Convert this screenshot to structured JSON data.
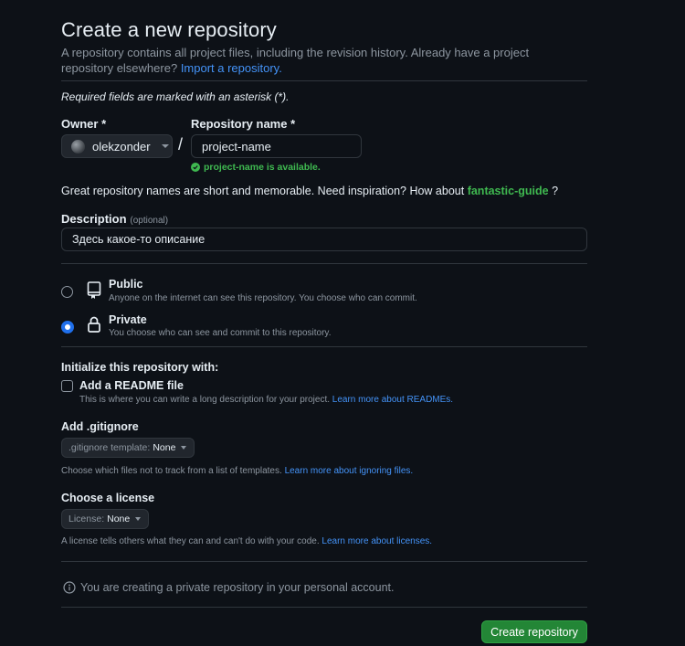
{
  "header": {
    "title": "Create a new repository",
    "subtitle_text": "A repository contains all project files, including the revision history. Already have a project repository elsewhere?",
    "import_link": "Import a repository."
  },
  "required_note": "Required fields are marked with an asterisk (*).",
  "owner": {
    "label": "Owner *",
    "value": "olekzonder"
  },
  "separator": "/",
  "repo_name": {
    "label": "Repository name *",
    "value": "project-name",
    "availability": "project-name is available."
  },
  "suggestion": {
    "text": "Great repository names are short and memorable. Need inspiration? How about",
    "name": "fantastic-guide",
    "suffix": "?"
  },
  "description": {
    "label": "Description",
    "optional": "(optional)",
    "value": "Здесь какое-то описание"
  },
  "visibility": {
    "public": {
      "title": "Public",
      "desc": "Anyone on the internet can see this repository. You choose who can commit.",
      "selected": false
    },
    "private": {
      "title": "Private",
      "desc": "You choose who can see and commit to this repository.",
      "selected": true
    }
  },
  "initialize": {
    "heading": "Initialize this repository with:",
    "readme_label": "Add a README file",
    "readme_desc": "This is where you can write a long description for your project.",
    "readme_link": "Learn more about READMEs.",
    "readme_checked": false
  },
  "gitignore": {
    "label": "Add .gitignore",
    "prefix": ".gitignore template:",
    "value": "None",
    "desc": "Choose which files not to track from a list of templates.",
    "link": "Learn more about ignoring files."
  },
  "license": {
    "label": "Choose a license",
    "prefix": "License:",
    "value": "None",
    "desc": "A license tells others what they can and can't do with your code.",
    "link": "Learn more about licenses."
  },
  "info_note": "You are creating a private repository in your personal account.",
  "submit_label": "Create repository",
  "colors": {
    "background": "#0d1117",
    "accent_link": "#4493f8",
    "success": "#3fb950",
    "button_green": "#238636",
    "radio_selected": "#1f6feb"
  }
}
